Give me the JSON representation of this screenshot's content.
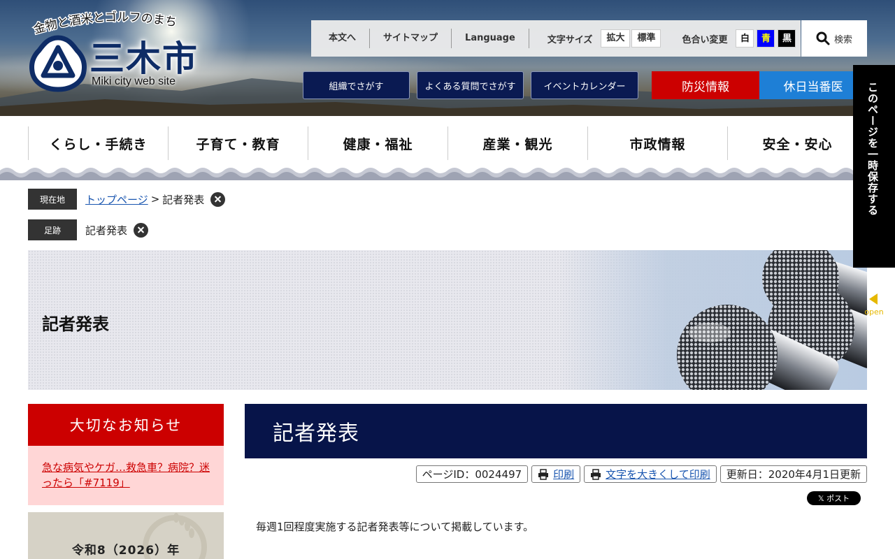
{
  "header": {
    "tagline": "金物と酒米とゴルフのまち",
    "city_name": "三木市",
    "city_sub": "Miki city web site"
  },
  "toolbar": {
    "skip_link": "本文へ",
    "sitemap": "サイトマップ",
    "language": "Language",
    "font_size_label": "文字サイズ",
    "font_larger": "拡大",
    "font_standard": "標準",
    "color_label": "色合い変更",
    "color_white": "白",
    "color_blue": "青",
    "color_black": "黒",
    "search": "検索"
  },
  "quick_links": {
    "org_search": "組織でさがす",
    "faq_search": "よくある質問でさがす",
    "event_calendar": "イベントカレンダー",
    "disaster_info": "防災情報",
    "holiday_doctor": "休日当番医"
  },
  "colors": {
    "navy": "#0a1a52",
    "disaster_red": "#cc0000",
    "holiday_blue": "#1e7fd6",
    "notice_red": "#cc0000",
    "title_bg": "#071449"
  },
  "mainnav": [
    "くらし・手続き",
    "子育て・教育",
    "健康・福祉",
    "産業・観光",
    "市政情報",
    "安全・安心"
  ],
  "breadcrumb": {
    "current_label": "現在地",
    "top_link": "トップページ",
    "separator": ">",
    "current": "記者発表",
    "history_label": "足跡",
    "history_item": "記者発表"
  },
  "hero": {
    "title": "記者発表"
  },
  "sidebar": {
    "notice_heading": "大切なお知らせ",
    "notice_link": "急な病気やケガ…救急車？病院？迷ったら「#7119」",
    "banner_text": "令和8（2026）年"
  },
  "content": {
    "title": "記者発表",
    "page_id": "ページID：0024497",
    "print": "印刷",
    "print_large": "文字を大きくして印刷",
    "updated": "更新日：2020年4月1日更新",
    "x_post": "𝕏 ポスト",
    "intro": "毎週1回程度実施する記者発表等について掲載しています。"
  },
  "save_tab": {
    "label": "このページを一時保存する",
    "open": "open"
  }
}
